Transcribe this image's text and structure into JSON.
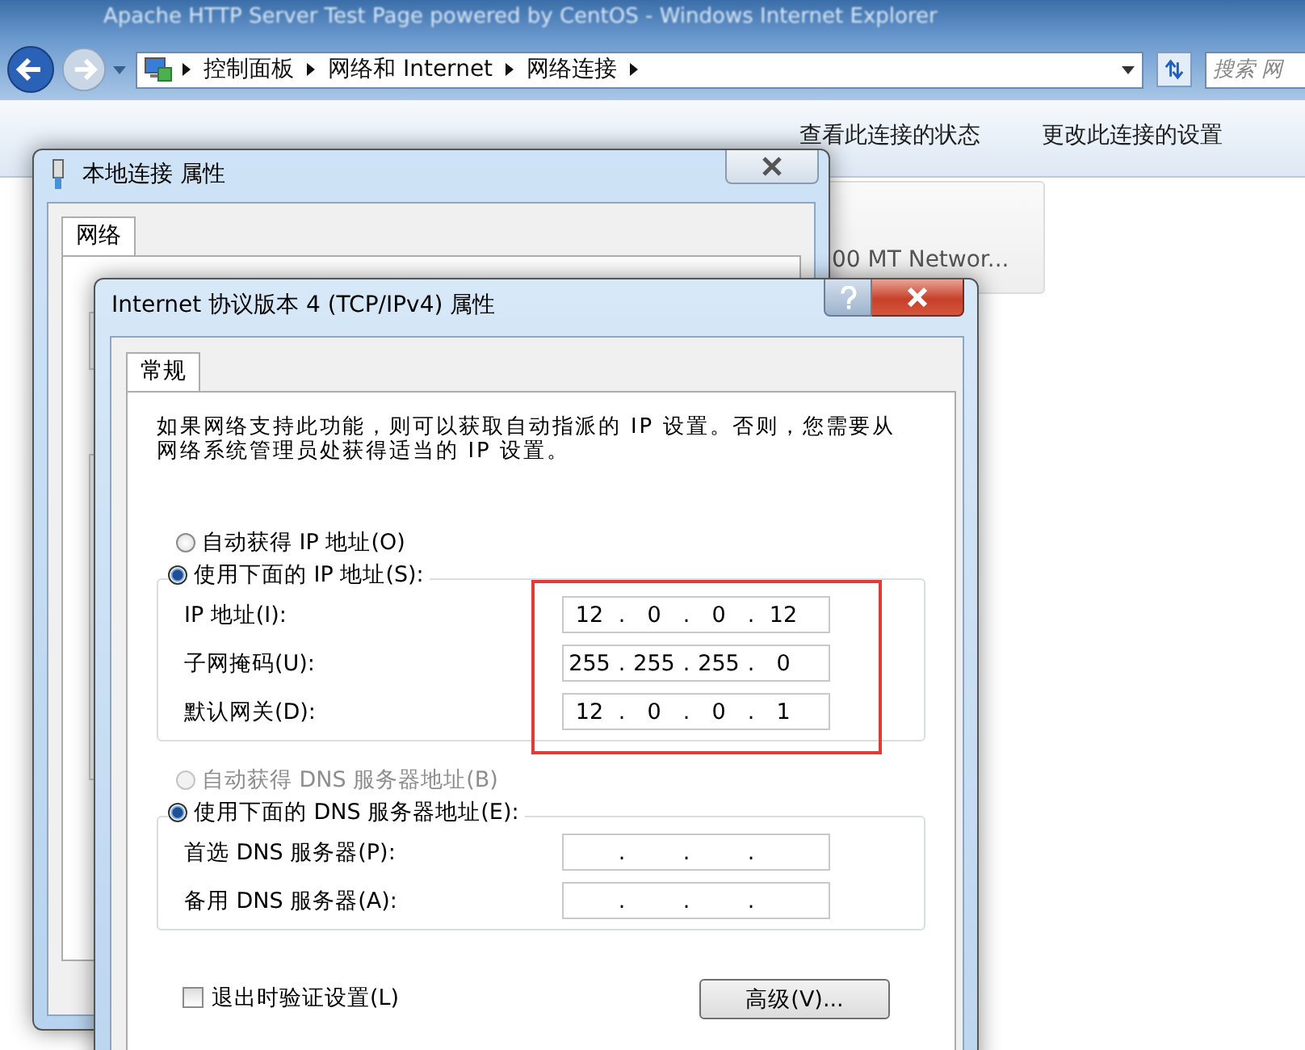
{
  "browser": {
    "title": "Apache HTTP Server Test Page powered by CentOS - Windows Internet Explorer",
    "breadcrumb": [
      "控制面板",
      "网络和 Internet",
      "网络连接"
    ],
    "search": {
      "placeholder": "搜索 网"
    },
    "toolbar": [
      {
        "label": "查看此连接的状态"
      },
      {
        "label": "更改此连接的设置"
      }
    ]
  },
  "adapter_card": {
    "text": "00 MT Networ..."
  },
  "back_dialog": {
    "title": "本地连接 属性",
    "tabs": [
      {
        "label": "网络",
        "selected": true
      }
    ]
  },
  "dialog": {
    "title": "Internet 协议版本 4 (TCP/IPv4) 属性",
    "tabs": [
      {
        "label": "常规",
        "selected": true
      }
    ],
    "description": "如果网络支持此功能，则可以获取自动指派的 IP 设置。否则，您需要从网络系统管理员处获得适当的 IP 设置。",
    "ip_mode": [
      {
        "label": "自动获得 IP 地址(O)",
        "selected": false,
        "disabled": false
      },
      {
        "label": "使用下面的 IP 地址(S):",
        "selected": true,
        "disabled": false
      }
    ],
    "ip_fields": [
      {
        "label": "IP 地址(I):",
        "octets": [
          "12",
          "0",
          "0",
          "12"
        ],
        "separators": [
          ".",
          ".",
          "."
        ]
      },
      {
        "label": "子网掩码(U):",
        "octets": [
          "255",
          "255",
          "255",
          "0"
        ],
        "separators": [
          ".",
          ".",
          "."
        ]
      },
      {
        "label": "默认网关(D):",
        "octets": [
          "12",
          "0",
          "0",
          "1"
        ],
        "separators": [
          ".",
          ".",
          "."
        ]
      }
    ],
    "ip_fields_highlighted": true,
    "dns_mode": [
      {
        "label": "自动获得 DNS 服务器地址(B)",
        "selected": false,
        "disabled": true
      },
      {
        "label": "使用下面的 DNS 服务器地址(E):",
        "selected": true,
        "disabled": false
      }
    ],
    "dns_fields": [
      {
        "label": "首选 DNS 服务器(P):",
        "separators": [
          ".",
          ".",
          "."
        ]
      },
      {
        "label": "备用 DNS 服务器(A):",
        "separators": [
          ".",
          ".",
          "."
        ]
      }
    ],
    "validate_on_exit": {
      "label": "退出时验证设置(L)",
      "checked": false
    },
    "advanced_button": "高级(V)..."
  }
}
